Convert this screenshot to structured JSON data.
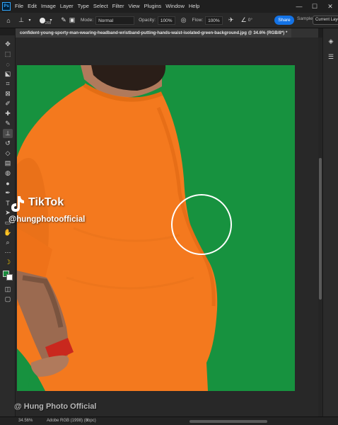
{
  "app": {
    "logo_text": "Ps",
    "menu": [
      "File",
      "Edit",
      "Image",
      "Layer",
      "Type",
      "Select",
      "Filter",
      "View",
      "Plugins",
      "Window",
      "Help"
    ],
    "window_icons": [
      "minimize-icon",
      "maximize-icon",
      "close-icon"
    ]
  },
  "options": {
    "brush_size": "268",
    "mode_label": "Mode:",
    "mode_value": "Normal",
    "opacity_label": "Opacity:",
    "opacity_value": "100%",
    "flow_label": "Flow:",
    "flow_value": "100%",
    "angle_value": "0°",
    "share_label": "Share",
    "sample_label": "Sample:",
    "sample_value": "Current Laye"
  },
  "document": {
    "tab_title": "confident-young-sporty-man-wearing-headband-wristband-putting-hands-waist-isolated-green-background.jpg @ 34.6% (RGB/8*) *"
  },
  "tools": [
    "move",
    "marquee",
    "lasso",
    "object-select",
    "crop",
    "frame",
    "eyedropper",
    "healing",
    "brush",
    "clone-stamp",
    "history-brush",
    "eraser",
    "gradient",
    "blur",
    "dodge",
    "pen",
    "type",
    "path-select",
    "rectangle",
    "hand",
    "zoom",
    "edit-toolbar"
  ],
  "colors": {
    "foreground": "#1a8a3c",
    "background": "#ffffff",
    "accent": "#1473e6",
    "green_screen": "#17923f",
    "shirt": "#f4791e"
  },
  "watermark": {
    "platform": "TikTok",
    "handle": "@hungphotoofficial",
    "credit": "@ Hung Photo Official"
  },
  "status": {
    "zoom": "34.56%",
    "profile": "Adobe RGB (1998) (8bpc)"
  }
}
